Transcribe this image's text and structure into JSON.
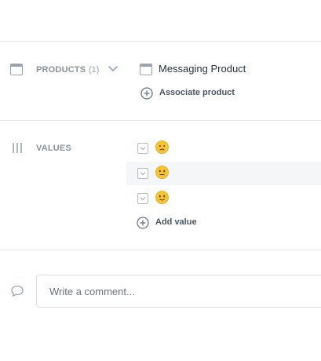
{
  "products": {
    "label": "PRODUCTS",
    "count": "(1)",
    "item": "Messaging Product",
    "associate_label": "Associate product"
  },
  "values": {
    "label": "VALUES",
    "items": [
      {
        "emoji": "frowning-face-icon",
        "checked": false
      },
      {
        "emoji": "neutral-face-icon",
        "checked": false
      },
      {
        "emoji": "slightly-smiling-face-icon",
        "checked": false
      }
    ],
    "add_label": "Add value"
  },
  "comment": {
    "placeholder": "Write a comment..."
  }
}
